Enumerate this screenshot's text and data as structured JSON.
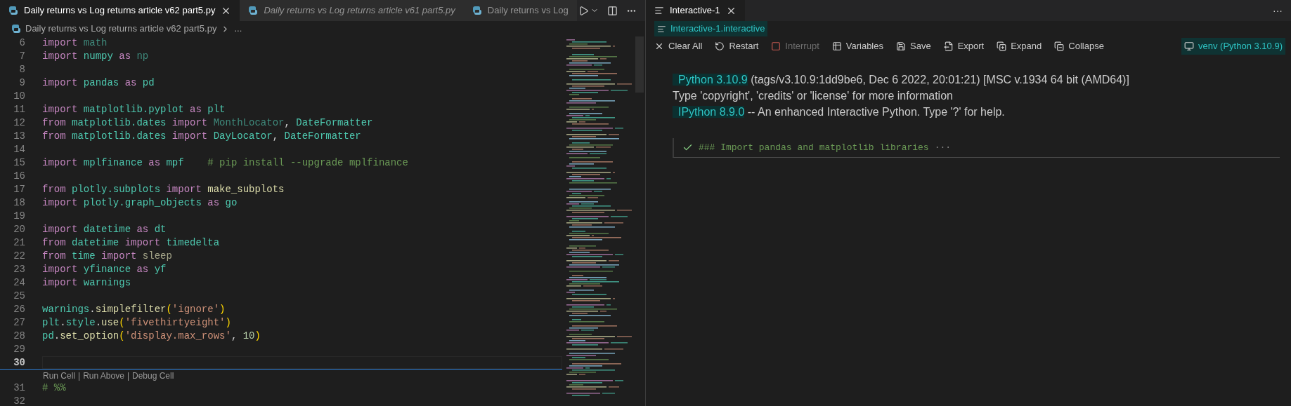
{
  "editor": {
    "tabs": [
      {
        "label": "Daily returns vs Log returns article v62 part5.py",
        "selected": true,
        "preview": false,
        "closable": true
      },
      {
        "label": "Daily returns vs Log returns article v61 part5.py",
        "selected": false,
        "preview": true,
        "closable": false
      },
      {
        "label": "Daily returns vs Log",
        "selected": false,
        "preview": false,
        "closable": false
      }
    ],
    "breadcrumb": {
      "file": "Daily returns vs Log returns article v62 part5.py",
      "more": "..."
    },
    "lines": [
      {
        "number": "6",
        "current": false,
        "tokens": [
          {
            "kind": "kw",
            "text": "import"
          },
          {
            "kind": "faded",
            "text": " math"
          }
        ]
      },
      {
        "number": "7",
        "current": false,
        "tokens": [
          {
            "kind": "kw",
            "text": "import"
          },
          {
            "kind": "mod",
            "text": " numpy"
          },
          {
            "kind": "kw",
            "text": " as"
          },
          {
            "kind": "faded",
            "text": " np"
          }
        ]
      },
      {
        "number": "8",
        "current": false
      },
      {
        "number": "9",
        "current": false,
        "tokens": [
          {
            "kind": "kw",
            "text": "import"
          },
          {
            "kind": "mod",
            "text": " pandas"
          },
          {
            "kind": "kw",
            "text": " as"
          },
          {
            "kind": "mod",
            "text": " pd"
          }
        ]
      },
      {
        "number": "10",
        "current": false
      },
      {
        "number": "11",
        "current": false,
        "tokens": [
          {
            "kind": "kw",
            "text": "import"
          },
          {
            "kind": "mod",
            "text": " matplotlib.pyplot"
          },
          {
            "kind": "kw",
            "text": " as"
          },
          {
            "kind": "mod",
            "text": " plt"
          }
        ]
      },
      {
        "number": "12",
        "current": false,
        "tokens": [
          {
            "kind": "kw",
            "text": "from"
          },
          {
            "kind": "mod",
            "text": " matplotlib.dates"
          },
          {
            "kind": "kw",
            "text": " import"
          },
          {
            "kind": "faded",
            "text": " MonthLocator"
          },
          {
            "kind": "punct",
            "text": ","
          },
          {
            "kind": "mod",
            "text": " DateFormatter"
          }
        ]
      },
      {
        "number": "13",
        "current": false,
        "tokens": [
          {
            "kind": "kw",
            "text": "from"
          },
          {
            "kind": "mod",
            "text": " matplotlib.dates"
          },
          {
            "kind": "kw",
            "text": " import"
          },
          {
            "kind": "mod",
            "text": " DayLocator"
          },
          {
            "kind": "punct",
            "text": ","
          },
          {
            "kind": "mod",
            "text": " DateFormatter"
          }
        ]
      },
      {
        "number": "14",
        "current": false
      },
      {
        "number": "15",
        "current": false,
        "tokens": [
          {
            "kind": "kw",
            "text": "import"
          },
          {
            "kind": "mod",
            "text": " mplfinance"
          },
          {
            "kind": "kw",
            "text": " as"
          },
          {
            "kind": "mod",
            "text": " mpf"
          },
          {
            "kind": "comment",
            "text": "    # pip install --upgrade mplfinance"
          }
        ]
      },
      {
        "number": "16",
        "current": false
      },
      {
        "number": "17",
        "current": false,
        "tokens": [
          {
            "kind": "kw",
            "text": "from"
          },
          {
            "kind": "mod",
            "text": " plotly.subplots"
          },
          {
            "kind": "kw",
            "text": " import"
          },
          {
            "kind": "func",
            "text": " make_subplots"
          }
        ]
      },
      {
        "number": "18",
        "current": false,
        "tokens": [
          {
            "kind": "kw",
            "text": "import"
          },
          {
            "kind": "mod",
            "text": " plotly.graph_objects"
          },
          {
            "kind": "kw",
            "text": " as"
          },
          {
            "kind": "mod",
            "text": " go"
          }
        ]
      },
      {
        "number": "19",
        "current": false
      },
      {
        "number": "20",
        "current": false,
        "tokens": [
          {
            "kind": "kw",
            "text": "import"
          },
          {
            "kind": "mod",
            "text": " datetime"
          },
          {
            "kind": "kw",
            "text": " as"
          },
          {
            "kind": "mod",
            "text": " dt"
          }
        ]
      },
      {
        "number": "21",
        "current": false,
        "tokens": [
          {
            "kind": "kw",
            "text": "from"
          },
          {
            "kind": "mod",
            "text": " datetime"
          },
          {
            "kind": "kw",
            "text": " import"
          },
          {
            "kind": "mod",
            "text": " timedelta"
          }
        ]
      },
      {
        "number": "22",
        "current": false,
        "tokens": [
          {
            "kind": "kw",
            "text": "from"
          },
          {
            "kind": "mod",
            "text": " time"
          },
          {
            "kind": "kw",
            "text": " import"
          },
          {
            "kind": "fadedfunc",
            "text": " sleep"
          }
        ]
      },
      {
        "number": "23",
        "current": false,
        "tokens": [
          {
            "kind": "kw",
            "text": "import"
          },
          {
            "kind": "mod",
            "text": " yfinance"
          },
          {
            "kind": "kw",
            "text": " as"
          },
          {
            "kind": "mod",
            "text": " yf"
          }
        ]
      },
      {
        "number": "24",
        "current": false,
        "tokens": [
          {
            "kind": "kw",
            "text": "import"
          },
          {
            "kind": "mod",
            "text": " warnings"
          }
        ]
      },
      {
        "number": "25",
        "current": false
      },
      {
        "number": "26",
        "current": false,
        "tokens": [
          {
            "kind": "mod",
            "text": "warnings"
          },
          {
            "kind": "punct",
            "text": "."
          },
          {
            "kind": "func",
            "text": "simplefilter"
          },
          {
            "kind": "paren",
            "text": "("
          },
          {
            "kind": "str",
            "text": "'ignore'"
          },
          {
            "kind": "paren",
            "text": ")"
          }
        ]
      },
      {
        "number": "27",
        "current": false,
        "tokens": [
          {
            "kind": "mod",
            "text": "plt"
          },
          {
            "kind": "punct",
            "text": "."
          },
          {
            "kind": "mod",
            "text": "style"
          },
          {
            "kind": "punct",
            "text": "."
          },
          {
            "kind": "func",
            "text": "use"
          },
          {
            "kind": "paren",
            "text": "("
          },
          {
            "kind": "str",
            "text": "'fivethirtyeight'"
          },
          {
            "kind": "paren",
            "text": ")"
          }
        ]
      },
      {
        "number": "28",
        "current": false,
        "tokens": [
          {
            "kind": "mod",
            "text": "pd"
          },
          {
            "kind": "punct",
            "text": "."
          },
          {
            "kind": "func",
            "text": "set_option"
          },
          {
            "kind": "paren",
            "text": "("
          },
          {
            "kind": "str",
            "text": "'display.max_rows'"
          },
          {
            "kind": "punct",
            "text": ","
          },
          {
            "kind": "num",
            "text": " 10"
          },
          {
            "kind": "paren",
            "text": ")"
          }
        ]
      },
      {
        "number": "29",
        "current": false
      },
      {
        "number": "30",
        "current": true
      },
      {
        "kind": "codelens",
        "links": [
          "Run Cell",
          "Run Above",
          "Debug Cell"
        ],
        "separator": "|"
      },
      {
        "number": "31",
        "current": false,
        "tokens": [
          {
            "kind": "comment",
            "text": "# %%"
          }
        ]
      },
      {
        "number": "32",
        "current": false
      }
    ]
  },
  "interactive": {
    "tabs": [
      {
        "label": "Interactive-1",
        "selected": true,
        "closable": true
      }
    ],
    "more": "···",
    "breadcrumb": "Interactive-1.interactive",
    "toolbar": [
      {
        "kind": "clear",
        "label": "Clear All",
        "disabled": false
      },
      {
        "kind": "restart",
        "label": "Restart",
        "disabled": false
      },
      {
        "kind": "interrupt",
        "label": "Interrupt",
        "disabled": true
      },
      {
        "kind": "variables",
        "label": "Variables",
        "disabled": false
      },
      {
        "kind": "save",
        "label": "Save",
        "disabled": false
      },
      {
        "kind": "export",
        "label": "Export",
        "disabled": false
      },
      {
        "kind": "expand",
        "label": "Expand",
        "disabled": false
      },
      {
        "kind": "collapse",
        "label": "Collapse",
        "disabled": false
      }
    ],
    "kernel": "venv (Python 3.10.9)",
    "output": [
      [
        {
          "text": "Python 3.10.9",
          "highlighted": true
        },
        {
          "text": " (tags/v3.10.9:1dd9be6, Dec 6 2022, 20:01:21) [MSC v.1934 64 bit (AMD64)]",
          "highlighted": false
        }
      ],
      [
        {
          "text": "Type 'copyright', 'credits' or 'license' for more information",
          "highlighted": false
        }
      ],
      [
        {
          "text": "IPython 8.9.0",
          "highlighted": true
        },
        {
          "text": " -- An enhanced Interactive Python. Type '?' for help.",
          "highlighted": false
        }
      ]
    ],
    "cells": [
      {
        "done": true,
        "text": "### Import pandas and matplotlib libraries",
        "ellipsis": "···"
      }
    ]
  }
}
